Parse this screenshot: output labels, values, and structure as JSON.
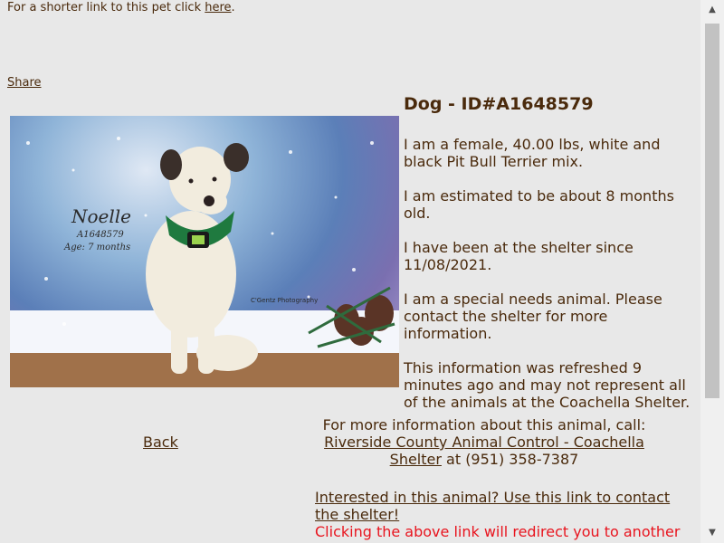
{
  "top": {
    "text": "For a shorter link to this pet click ",
    "link": "here",
    "suffix": "."
  },
  "share": "Share",
  "photo": {
    "name": "Noelle",
    "id": "A1648579",
    "age": "Age: 7 months",
    "credit": "C'Gentz Photography"
  },
  "title": "Dog - ID#A1648579",
  "details": [
    "I am a female, 40.00 lbs, white and black Pit Bull Terrier mix.",
    "I am estimated to be about 8 months old.",
    "I have been at the shelter since 11/08/2021.",
    "I am a special needs animal. Please contact the shelter for more information.",
    "This information was refreshed 9 minutes ago and may not represent all of the animals at the Coachella Shelter."
  ],
  "back": "Back",
  "contact": {
    "intro": "For more information about this animal, call:",
    "link": "Riverside County Animal Control - Coachella Shelter",
    "phone_prefix": " at ",
    "phone": "(951) 358-7387"
  },
  "contact_link": "Interested in this animal? Use this link to contact the shelter!",
  "redirect_note": "Clicking the above link will redirect you to another",
  "scrollbar": {
    "up_icon": "▲",
    "down_icon": "▼"
  }
}
